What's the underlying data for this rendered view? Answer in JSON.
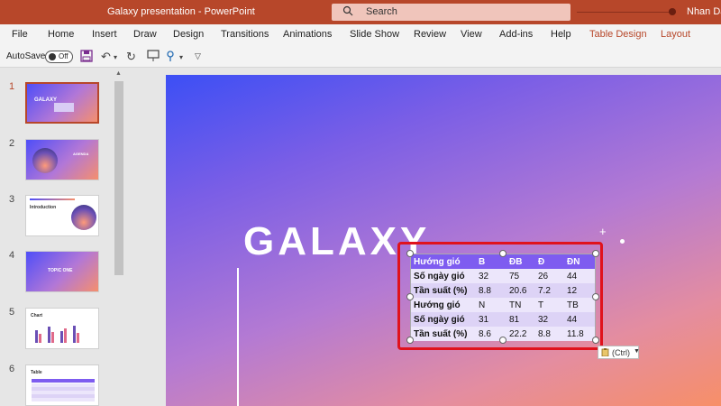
{
  "window": {
    "title": "Galaxy presentation  -  PowerPoint",
    "search_placeholder": "Search",
    "user": "Nhan Da"
  },
  "ribbon_tabs": [
    "File",
    "Home",
    "Insert",
    "Draw",
    "Design",
    "Transitions",
    "Animations",
    "Slide Show",
    "Review",
    "View",
    "Add-ins",
    "Help",
    "Table Design",
    "Layout"
  ],
  "qat": {
    "autosave_label": "AutoSave",
    "autosave_state": "Off",
    "icons": [
      "save-icon",
      "undo-icon",
      "redo-icon",
      "present-icon",
      "touch-mode-icon",
      "customize-icon"
    ]
  },
  "thumbnails": [
    {
      "number": "1",
      "title": "GALAXY"
    },
    {
      "number": "2",
      "title": "AGENDA"
    },
    {
      "number": "3",
      "title": "Introduction"
    },
    {
      "number": "4",
      "title": "TOPIC ONE"
    },
    {
      "number": "5",
      "title": "Chart"
    },
    {
      "number": "6",
      "title": "Table"
    }
  ],
  "slide": {
    "title": "GALAXY"
  },
  "table": {
    "rows": [
      {
        "cells": [
          "Hướng gió",
          "B",
          "ĐB",
          "Đ",
          "ĐN"
        ]
      },
      {
        "cells": [
          "Số ngày gió",
          "32",
          "75",
          "26",
          "44"
        ]
      },
      {
        "cells": [
          "Tần suất (%)",
          "8.8",
          "20.6",
          "7.2",
          "12"
        ]
      },
      {
        "cells": [
          "Hướng gió",
          "N",
          "TN",
          "T",
          "TB"
        ]
      },
      {
        "cells": [
          "Số ngày gió",
          "31",
          "81",
          "32",
          "44"
        ]
      },
      {
        "cells": [
          "Tần suất (%)",
          "8.6",
          "22.2",
          "8.8",
          "11.8"
        ]
      }
    ]
  },
  "paste_options": {
    "label": "(Ctrl)"
  },
  "colors": {
    "accent": "#b7472a",
    "table_header": "#7e5cf0",
    "highlight": "#e0121c"
  }
}
